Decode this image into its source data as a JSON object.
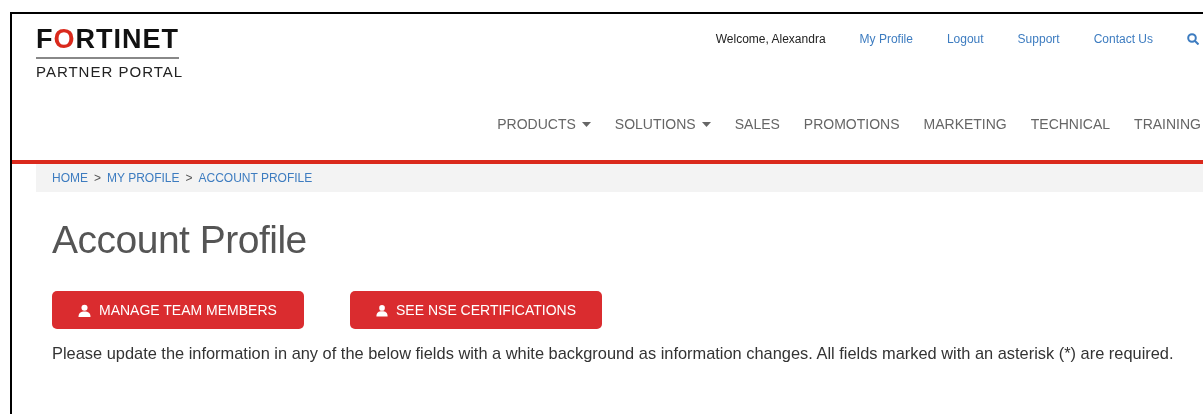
{
  "logo": {
    "wordmark": "FORTINET",
    "subtitle": "PARTNER PORTAL"
  },
  "top_links": [
    {
      "label": "Welcome, Alexandra",
      "kind": "text"
    },
    {
      "label": "My Profile",
      "kind": "link"
    },
    {
      "label": "Logout",
      "kind": "link"
    },
    {
      "label": "Support",
      "kind": "link"
    },
    {
      "label": "Contact Us",
      "kind": "link"
    }
  ],
  "nav": [
    {
      "label": "PRODUCTS",
      "has_menu": true
    },
    {
      "label": "SOLUTIONS",
      "has_menu": true
    },
    {
      "label": "SALES",
      "has_menu": false
    },
    {
      "label": "PROMOTIONS",
      "has_menu": false
    },
    {
      "label": "MARKETING",
      "has_menu": false
    },
    {
      "label": "TECHNICAL",
      "has_menu": false
    },
    {
      "label": "TRAINING",
      "has_menu": false
    }
  ],
  "breadcrumb": [
    {
      "label": "HOME"
    },
    {
      "label": "MY PROFILE"
    },
    {
      "label": "ACCOUNT PROFILE"
    }
  ],
  "breadcrumb_separator": ">",
  "title": "Account Profile",
  "buttons": [
    {
      "label": "MANAGE TEAM MEMBERS"
    },
    {
      "label": "SEE NSE CERTIFICATIONS"
    }
  ],
  "intro": "Please update the information in any of the below fields with a white background as information changes. All fields marked with an asterisk (*) are required."
}
